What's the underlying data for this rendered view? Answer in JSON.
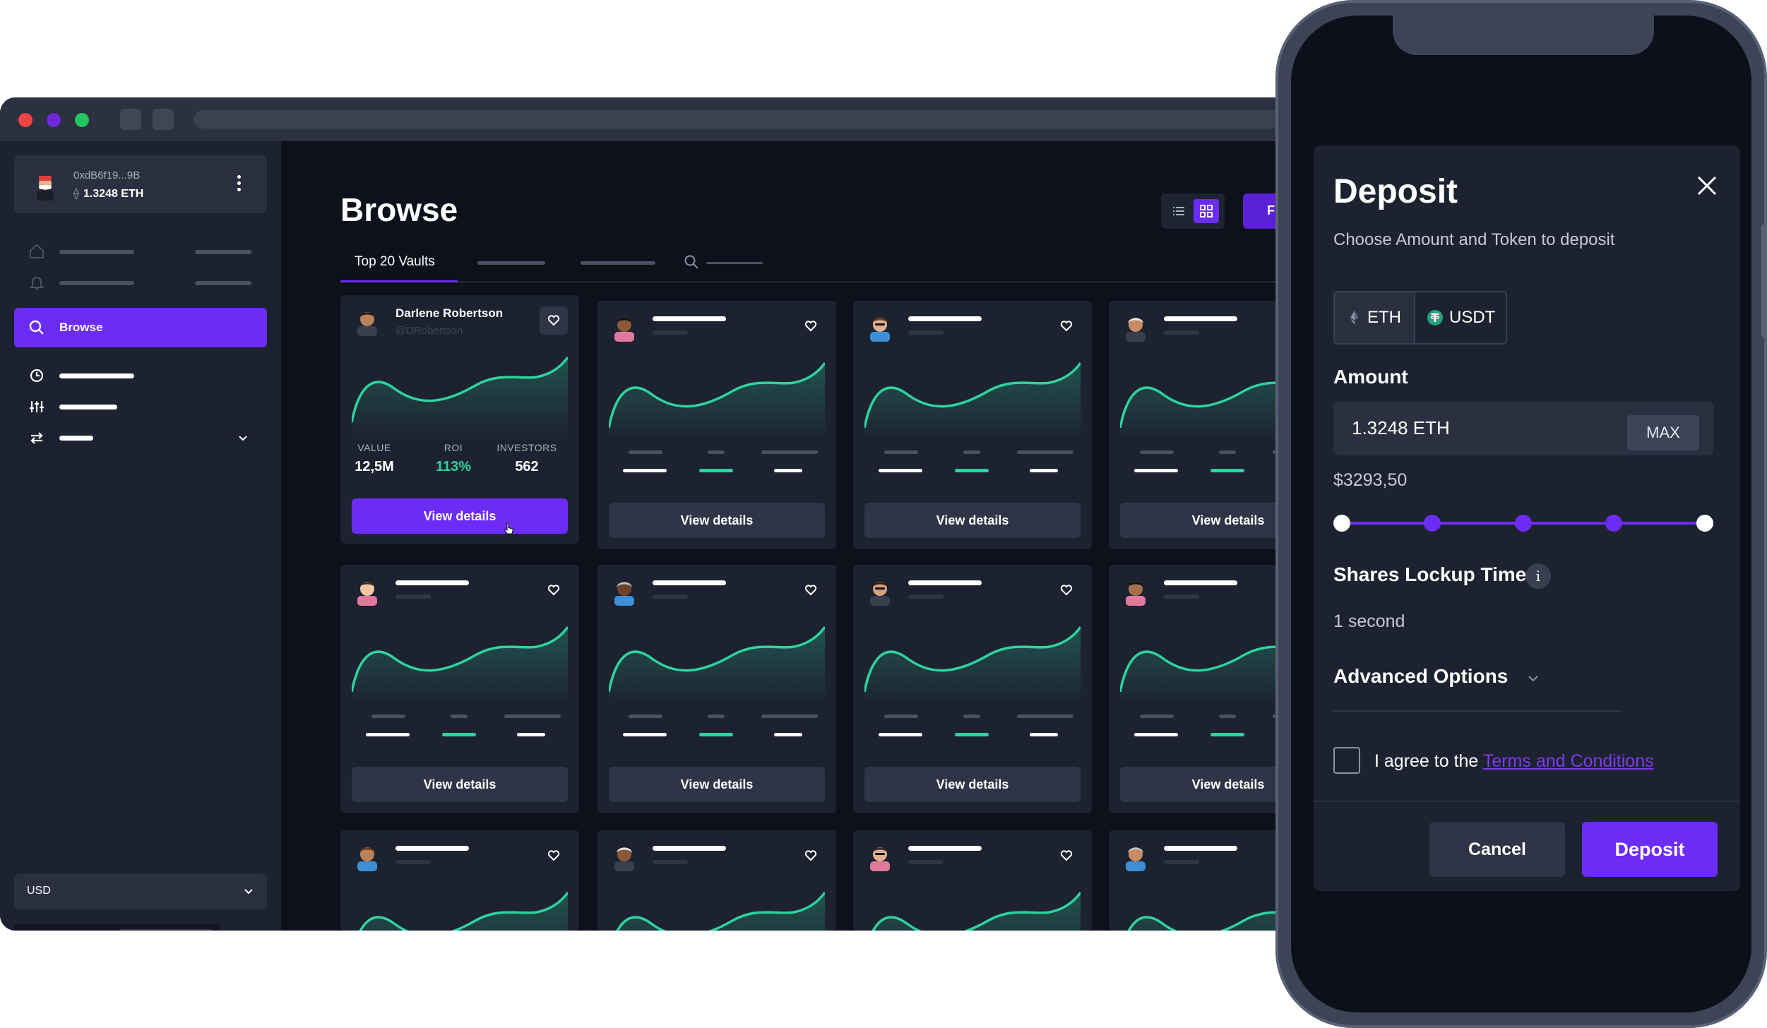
{
  "wallet": {
    "address": "0xdB6f19...9B",
    "balance": "1.3248 ETH",
    "eth_glyph": "⟠"
  },
  "sidebar": {
    "active_item": "Browse"
  },
  "currency": "USD",
  "browse": {
    "title": "Browse",
    "active_tab": "Top 20 Vaults",
    "featured": {
      "name": "Darlene Robertson",
      "handle": "@DRobertson",
      "stats": [
        {
          "label": "VALUE",
          "value": "12,5M"
        },
        {
          "label": "ROI",
          "value": "113%"
        },
        {
          "label": "INVESTORS",
          "value": "562"
        }
      ]
    },
    "view_details_label": "View details",
    "primary_edge_label": "F"
  },
  "deposit": {
    "title": "Deposit",
    "subtitle": "Choose Amount and Token to deposit",
    "tokens": [
      "ETH",
      "USDT"
    ],
    "selected_token": "ETH",
    "amount_label": "Amount",
    "amount_value": "1.3248  ETH",
    "max_label": "MAX",
    "usd_value": "$3293,50",
    "lockup_label": "Shares Lockup Time",
    "lockup_value": "1 second",
    "info_glyph": "i",
    "advanced_label": "Advanced Options",
    "agree_prefix": "I agree to the ",
    "terms_link": "Terms and Conditions",
    "cancel_label": "Cancel",
    "deposit_label": "Deposit"
  },
  "colors": {
    "accent": "#6b2cf5",
    "positive": "#2ed3a0",
    "background": "#0d111c",
    "panel": "#1d2230"
  },
  "icons": [
    "home-icon",
    "bell-icon",
    "search-icon",
    "clock-icon",
    "sliders-icon",
    "swap-icon",
    "chevron-down-icon",
    "sun-icon",
    "moon-icon",
    "gear-icon",
    "list-view-icon",
    "grid-view-icon",
    "heart-icon",
    "close-icon",
    "eth-icon",
    "usdt-icon",
    "info-icon"
  ]
}
